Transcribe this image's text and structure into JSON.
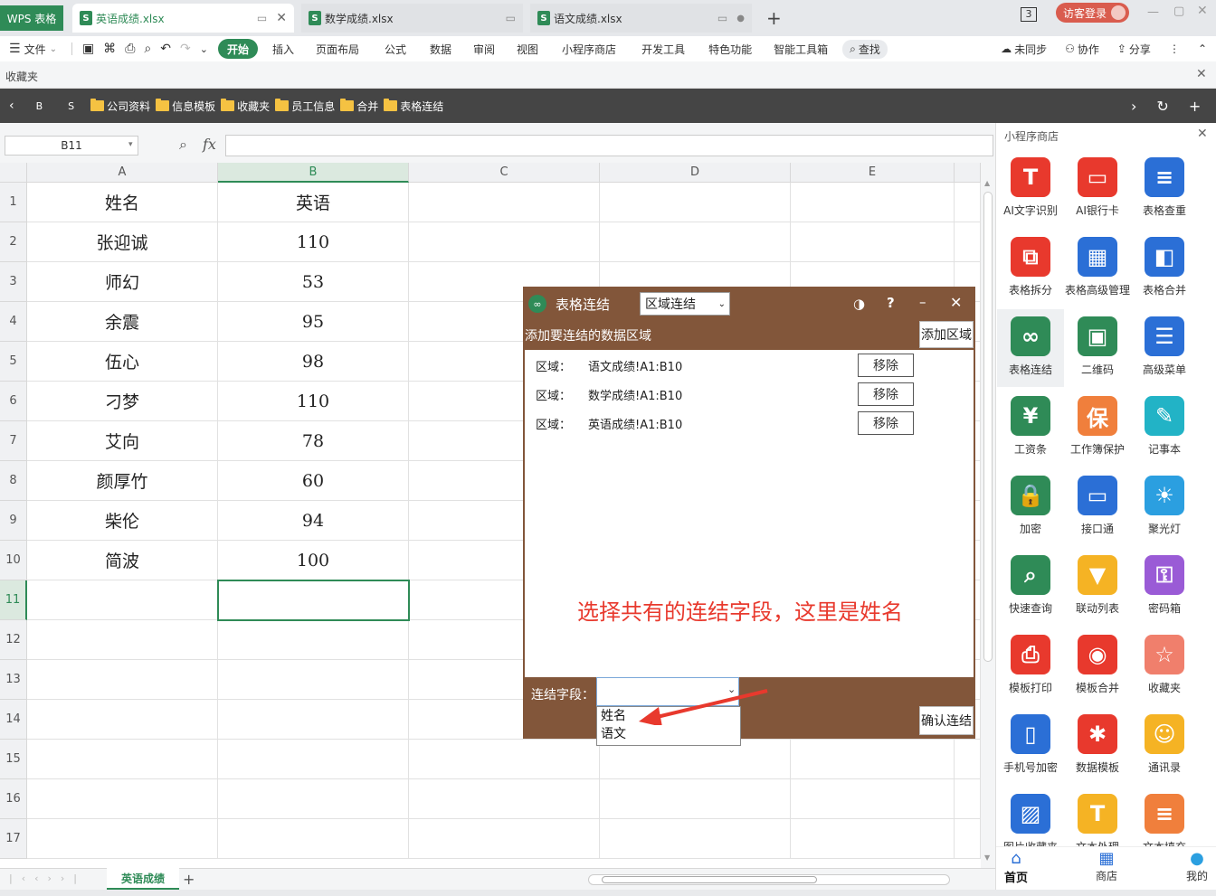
{
  "app": {
    "logo": "WPS 表格",
    "tabs": [
      {
        "name": "英语成绩.xlsx",
        "active": true
      },
      {
        "name": "数学成绩.xlsx",
        "active": false
      },
      {
        "name": "语文成绩.xlsx",
        "active": false
      }
    ],
    "new_tab": "+",
    "window_badge": "3",
    "login": "访客登录"
  },
  "menu": {
    "file": "文件",
    "start": "开始",
    "items": [
      "插入",
      "页面布局",
      "公式",
      "数据",
      "审阅",
      "视图",
      "小程序商店",
      "开发工具",
      "特色功能",
      "智能工具箱"
    ],
    "search": "查找",
    "sync": "未同步",
    "collab": "协作",
    "share": "分享"
  },
  "favorites": {
    "label": "收藏夹",
    "items": [
      "B",
      "S",
      "公司资料",
      "信息模板",
      "收藏夹",
      "员工信息",
      "合并",
      "表格连结"
    ]
  },
  "formula": {
    "cell_ref": "B11",
    "fx": "fx"
  },
  "sheet": {
    "columns": [
      "A",
      "B",
      "C",
      "D",
      "E"
    ],
    "rows": [
      {
        "n": "1",
        "a": "姓名",
        "b": "英语"
      },
      {
        "n": "2",
        "a": "张迎诚",
        "b": "110"
      },
      {
        "n": "3",
        "a": "师幻",
        "b": "53"
      },
      {
        "n": "4",
        "a": "余震",
        "b": "95"
      },
      {
        "n": "5",
        "a": "伍心",
        "b": "98"
      },
      {
        "n": "6",
        "a": "刁梦",
        "b": "110"
      },
      {
        "n": "7",
        "a": "艾向",
        "b": "78"
      },
      {
        "n": "8",
        "a": "颜厚竹",
        "b": "60"
      },
      {
        "n": "9",
        "a": "柴伦",
        "b": "94"
      },
      {
        "n": "10",
        "a": "简波",
        "b": "100"
      },
      {
        "n": "11",
        "a": "",
        "b": ""
      },
      {
        "n": "12",
        "a": "",
        "b": ""
      },
      {
        "n": "13",
        "a": "",
        "b": ""
      },
      {
        "n": "14",
        "a": "",
        "b": ""
      },
      {
        "n": "15",
        "a": "",
        "b": ""
      },
      {
        "n": "16",
        "a": "",
        "b": ""
      },
      {
        "n": "17",
        "a": "",
        "b": ""
      }
    ],
    "sheet_tab": "英语成绩",
    "add_sheet": "+"
  },
  "panel": {
    "title": "小程序商店",
    "apps": [
      {
        "label": "AI文字识别",
        "icon": "text-recognition-icon",
        "color": "#e8392d",
        "glyph": "T"
      },
      {
        "label": "AI银行卡",
        "icon": "bank-card-icon",
        "color": "#e8392d",
        "glyph": "▭"
      },
      {
        "label": "表格查重",
        "icon": "table-dedupe-icon",
        "color": "#2b6fd6",
        "glyph": "≡"
      },
      {
        "label": "表格拆分",
        "icon": "table-split-icon",
        "color": "#e8392d",
        "glyph": "⧉"
      },
      {
        "label": "表格高级管理",
        "icon": "table-advanced-icon",
        "color": "#2b6fd6",
        "glyph": "▦"
      },
      {
        "label": "表格合并",
        "icon": "table-merge-icon",
        "color": "#2b6fd6",
        "glyph": "◧"
      },
      {
        "label": "表格连结",
        "icon": "table-link-icon",
        "color": "#2f8b57",
        "glyph": "∞"
      },
      {
        "label": "二维码",
        "icon": "qrcode-icon",
        "color": "#2f8b57",
        "glyph": "▣"
      },
      {
        "label": "高级菜单",
        "icon": "advanced-menu-icon",
        "color": "#2b6fd6",
        "glyph": "☰"
      },
      {
        "label": "工资条",
        "icon": "payslip-icon",
        "color": "#2f8b57",
        "glyph": "¥"
      },
      {
        "label": "工作簿保护",
        "icon": "workbook-protect-icon",
        "color": "#f07f3c",
        "glyph": "保"
      },
      {
        "label": "记事本",
        "icon": "notepad-icon",
        "color": "#22b3c6",
        "glyph": "✎"
      },
      {
        "label": "加密",
        "icon": "lock-icon",
        "color": "#2f8b57",
        "glyph": "🔒"
      },
      {
        "label": "接口通",
        "icon": "monitor-icon",
        "color": "#2b6fd6",
        "glyph": "▭"
      },
      {
        "label": "聚光灯",
        "icon": "spotlight-icon",
        "color": "#2b9fe0",
        "glyph": "☀"
      },
      {
        "label": "快速查询",
        "icon": "quick-search-icon",
        "color": "#2f8b57",
        "glyph": "⌕"
      },
      {
        "label": "联动列表",
        "icon": "linked-list-icon",
        "color": "#f5b324",
        "glyph": "▼"
      },
      {
        "label": "密码箱",
        "icon": "password-box-icon",
        "color": "#9a5bd6",
        "glyph": "⚿"
      },
      {
        "label": "模板打印",
        "icon": "template-print-icon",
        "color": "#e8392d",
        "glyph": "⎙"
      },
      {
        "label": "模板合并",
        "icon": "template-merge-icon",
        "color": "#e8392d",
        "glyph": "◉"
      },
      {
        "label": "收藏夹",
        "icon": "favorites-icon",
        "color": "#f07f6c",
        "glyph": "☆"
      },
      {
        "label": "手机号加密",
        "icon": "phone-encrypt-icon",
        "color": "#2b6fd6",
        "glyph": "▯"
      },
      {
        "label": "数据模板",
        "icon": "data-template-icon",
        "color": "#e8392d",
        "glyph": "✱"
      },
      {
        "label": "通讯录",
        "icon": "contacts-icon",
        "color": "#f5b324",
        "glyph": "☺"
      },
      {
        "label": "图片收藏夹",
        "icon": "image-favorites-icon",
        "color": "#2b6fd6",
        "glyph": "▨"
      },
      {
        "label": "文本处理",
        "icon": "text-process-icon",
        "color": "#f5b324",
        "glyph": "T"
      },
      {
        "label": "文本填充",
        "icon": "text-fill-icon",
        "color": "#f07f3c",
        "glyph": "≡"
      }
    ],
    "nav": {
      "home": "首页",
      "store": "商店",
      "mine": "我的"
    }
  },
  "dialog": {
    "title": "表格连结",
    "mode": "区域连结",
    "help": "?",
    "add_hint": "添加要连结的数据区域",
    "add_button": "添加区域",
    "region_label": "区域：",
    "regions": [
      "语文成绩!A1:B10",
      "数学成绩!A1:B10",
      "英语成绩!A1:B10"
    ],
    "remove_label": "移除",
    "annotation": "选择共有的连结字段，这里是姓名",
    "field_label": "连结字段：",
    "field_options": [
      "姓名",
      "语文"
    ],
    "confirm_button": "确认连结",
    "accent_color": "#82563a",
    "annotation_color": "#e8392d"
  }
}
